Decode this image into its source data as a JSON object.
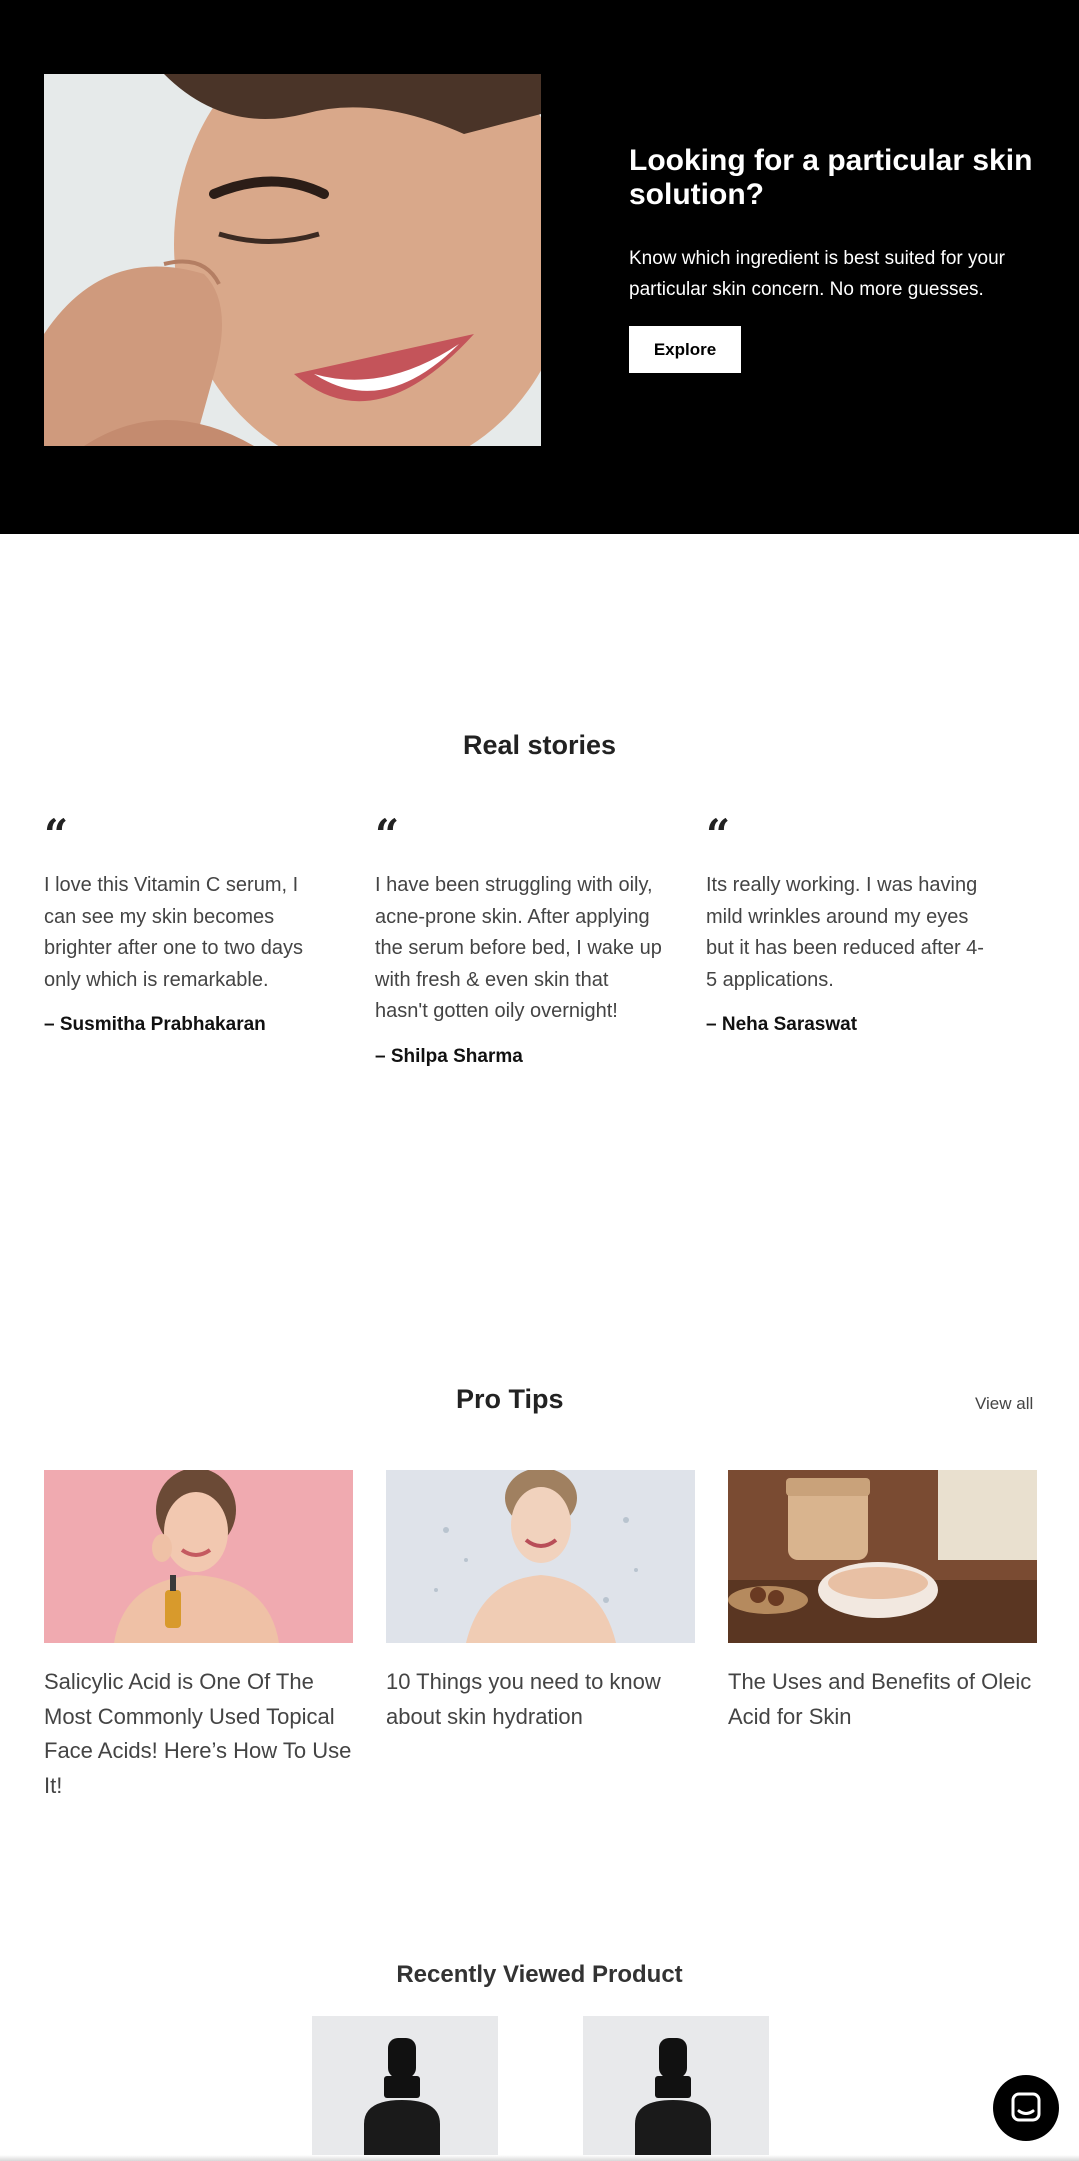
{
  "hero": {
    "title": "Looking for a particular skin solution?",
    "text": "Know which ingredient is best suited for your particular skin concern. No more guesses.",
    "button_label": "Explore",
    "background": "#000000"
  },
  "stories": {
    "title": "Real stories",
    "items": [
      {
        "quote_icon": "quote-icon",
        "text": "I love this Vitamin C serum, I can see my skin becomes brighter after one to two days only which is remarkable.",
        "author": "– Susmitha Prabhakaran"
      },
      {
        "quote_icon": "quote-icon",
        "text": "I have been struggling with oily, acne-prone skin. After applying the serum before bed, I wake up with fresh & even skin that hasn't gotten oily overnight!",
        "author": "– Shilpa Sharma"
      },
      {
        "quote_icon": "quote-icon",
        "text": "Its really working. I was having mild wrinkles around my eyes but it has been reduced after 4-5 applications.",
        "author": "– Neha Saraswat"
      }
    ]
  },
  "pro_tips": {
    "title": "Pro Tips",
    "view_all": "View all",
    "articles": [
      {
        "title": "Salicylic Acid is One Of The Most Commonly Used Topical Face Acids! Here’s How To Use It!"
      },
      {
        "title": "10 Things you need to know about skin hydration"
      },
      {
        "title": "The Uses and Benefits of Oleic Acid for Skin"
      }
    ]
  },
  "recently_viewed": {
    "title": "Recently Viewed Product"
  },
  "chat": {
    "icon": "chat-icon"
  }
}
